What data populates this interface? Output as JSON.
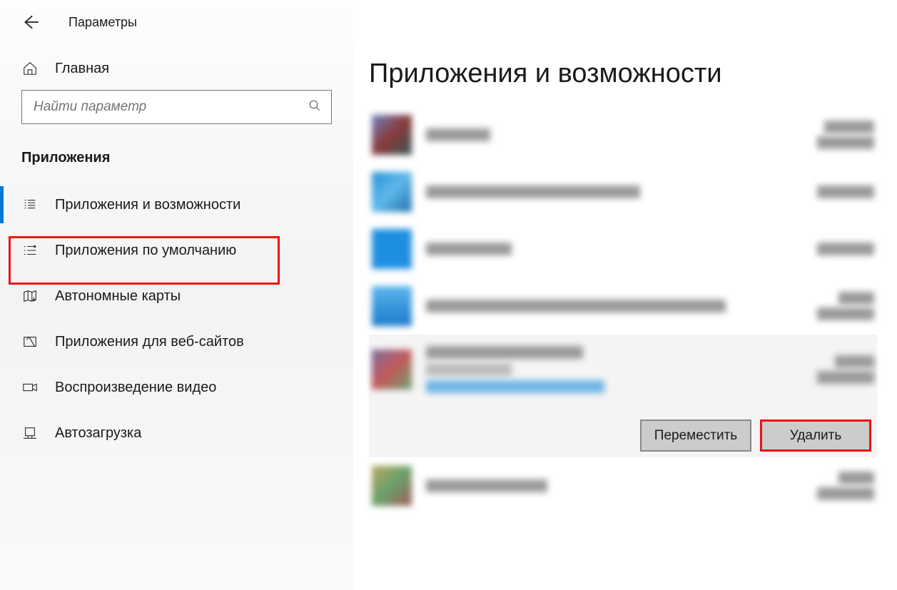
{
  "header": {
    "title": "Параметры"
  },
  "sidebar": {
    "home_label": "Главная",
    "search_placeholder": "Найти параметр",
    "section_label": "Приложения",
    "items": [
      {
        "id": "apps-features",
        "label": "Приложения и возможности",
        "active": true
      },
      {
        "id": "default-apps",
        "label": "Приложения по умолчанию",
        "active": false
      },
      {
        "id": "offline-maps",
        "label": "Автономные карты",
        "active": false
      },
      {
        "id": "apps-websites",
        "label": "Приложения для веб-сайтов",
        "active": false
      },
      {
        "id": "video-playback",
        "label": "Воспроизведение видео",
        "active": false
      },
      {
        "id": "startup",
        "label": "Автозагрузка",
        "active": false
      }
    ]
  },
  "main": {
    "title": "Приложения и возможности",
    "actions": {
      "move": "Переместить",
      "uninstall": "Удалить"
    }
  }
}
